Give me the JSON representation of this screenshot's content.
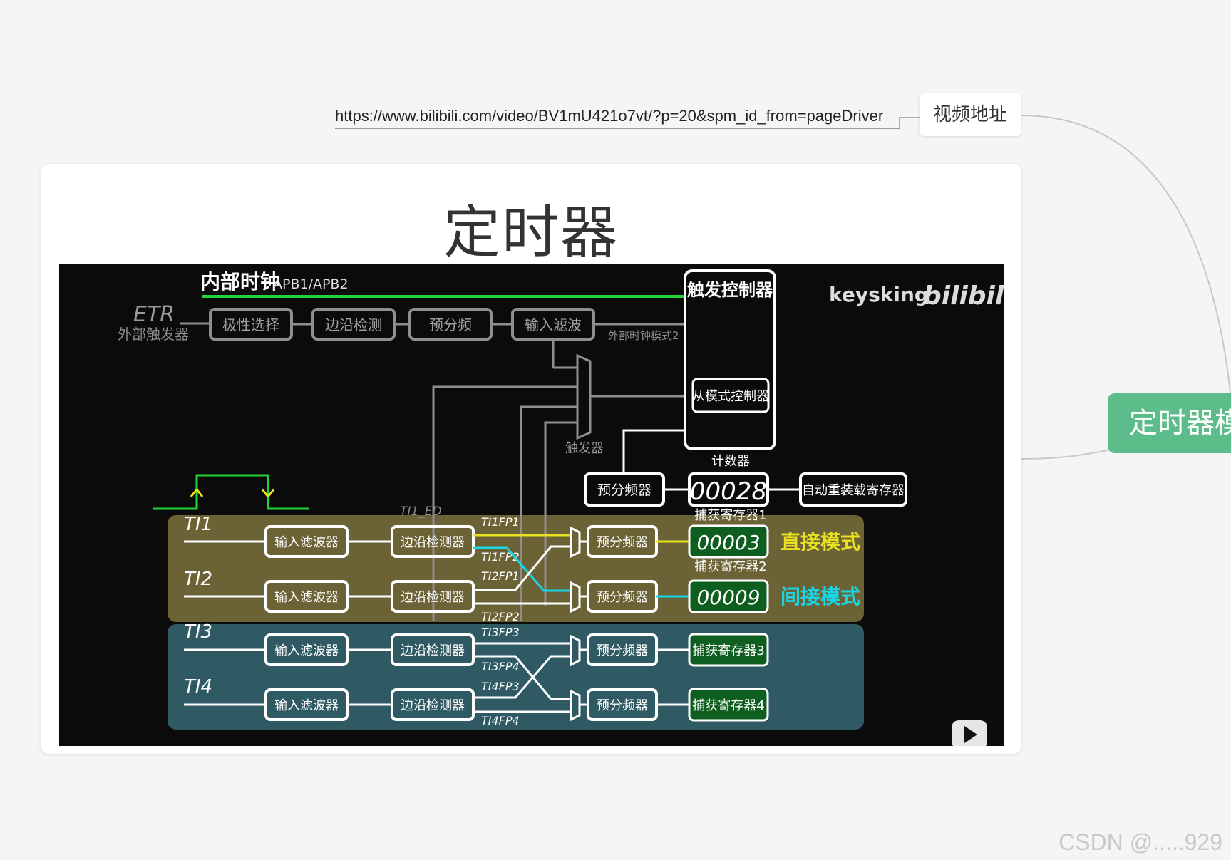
{
  "mindmap": {
    "url_text": "https://www.bilibili.com/video/BV1mU421o7vt/?p=20&spm_id_from=pageDriver",
    "video_label": "视频地址",
    "root_label": "定时器模",
    "card_title": "定时器"
  },
  "diagram": {
    "header": "内部时钟",
    "header_sub": "APB1/APB2",
    "trigger_controller": "触发控制器",
    "slave_controller": "从模式控制器",
    "brand": "keysking",
    "brand_logo": "bilibili",
    "etr": "ETR",
    "etr_sub": "外部触发器",
    "etr_chain": [
      "极性选择",
      "边沿检测",
      "预分频",
      "输入滤波"
    ],
    "ext_clock_mode2": "外部时钟模式2",
    "trigger": "触发器",
    "counter_label": "计数器",
    "counter_prescaler": "预分频器",
    "counter_value": "00028",
    "auto_reload": "自动重装载寄存器",
    "ti1_ed": "TI1_ED",
    "capture1_label": "捕获寄存器1",
    "capture2_label": "捕获寄存器2",
    "direct_mode": "直接模式",
    "indirect_mode": "间接模式",
    "channels": [
      {
        "name": "TI1",
        "filter": "输入滤波器",
        "edge": "边沿检测器",
        "prescaler": "预分频器",
        "capture": "00003"
      },
      {
        "name": "TI2",
        "filter": "输入滤波器",
        "edge": "边沿检测器",
        "prescaler": "预分频器",
        "capture": "00009"
      },
      {
        "name": "TI3",
        "filter": "输入滤波器",
        "edge": "边沿检测器",
        "prescaler": "预分频器",
        "capture": "捕获寄存器3"
      },
      {
        "name": "TI4",
        "filter": "输入滤波器",
        "edge": "边沿检测器",
        "prescaler": "预分频器",
        "capture": "捕获寄存器4"
      }
    ],
    "signals": [
      "TI1FP1",
      "TI1FP2",
      "TI2FP1",
      "TI2FP2",
      "TI3FP3",
      "TI3FP4",
      "TI4FP3",
      "TI4FP4"
    ],
    "colors": {
      "green": "#22d33a",
      "yellow": "#e8e020",
      "cyan": "#19d6e6",
      "olive": "#6b6235",
      "teal": "#2f5a64"
    }
  },
  "watermark": "CSDN @.....929"
}
